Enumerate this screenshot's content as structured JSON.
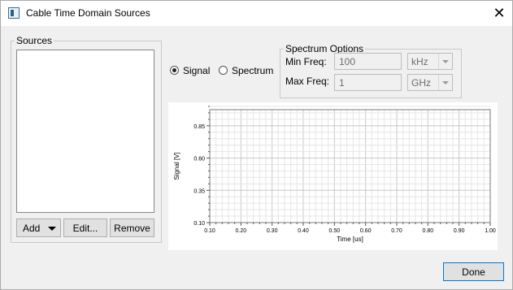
{
  "window": {
    "title": "Cable Time Domain Sources",
    "close_glyph": "✕"
  },
  "sources": {
    "legend": "Sources",
    "items": [],
    "add_label": "Add",
    "edit_label": "Edit...",
    "remove_label": "Remove"
  },
  "view_mode": {
    "signal_label": "Signal",
    "spectrum_label": "Spectrum",
    "selected": "Signal"
  },
  "spectrum_options": {
    "legend": "Spectrum Options",
    "min_freq_label": "Min Freq:",
    "min_freq_value": "100",
    "min_freq_unit": "kHz",
    "max_freq_label": "Max Freq:",
    "max_freq_value": "1",
    "max_freq_unit": "GHz"
  },
  "done_label": "Done",
  "chart_data": {
    "type": "line",
    "series": [],
    "xlabel": "Time [us]",
    "ylabel": "Signal [V]",
    "xlim": [
      0.1,
      1.0
    ],
    "ylim": [
      0.1,
      0.975
    ],
    "xticks": [
      "0.10",
      "0.20",
      "0.30",
      "0.40",
      "0.50",
      "0.60",
      "0.70",
      "0.80",
      "0.90",
      "1.00"
    ],
    "yticks": [
      "0.10",
      "0.35",
      "0.60",
      "0.85"
    ],
    "grid": true
  }
}
